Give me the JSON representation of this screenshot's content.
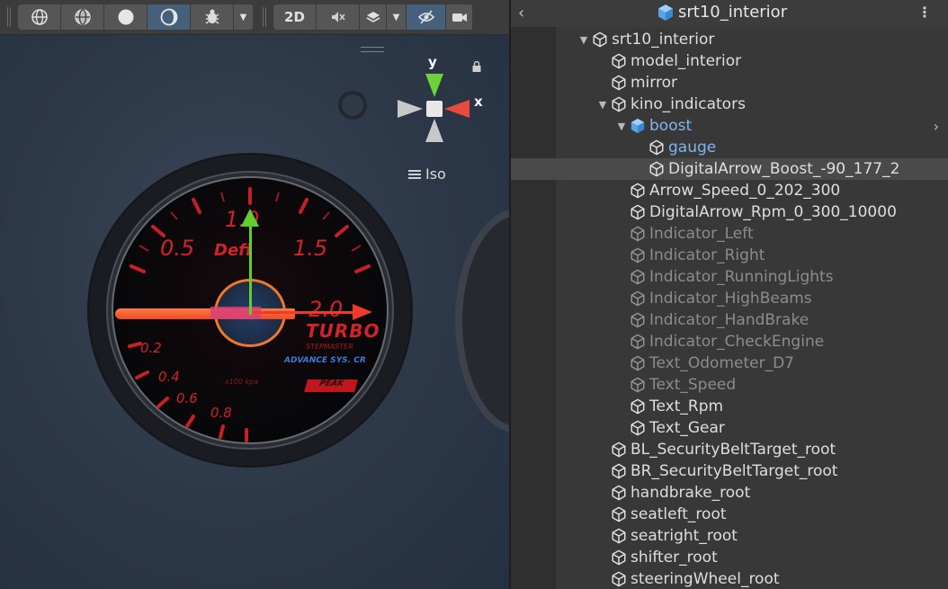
{
  "toolbar": {
    "buttons": [
      {
        "name": "wireframe-shading-button",
        "icon": "globe-wireframe-icon"
      },
      {
        "name": "shaded-wireframe-button",
        "icon": "globe-shaded-icon"
      },
      {
        "name": "shaded-button",
        "icon": "sphere-solid-icon"
      },
      {
        "name": "unlit-button",
        "icon": "moon-icon",
        "active": true
      },
      {
        "name": "debug-button",
        "icon": "bug-icon"
      }
    ],
    "mode_2d": "2D",
    "audio_icon": "speaker-muted-icon",
    "effects_icon": "layers-icon",
    "visibility_icon": "eye-off-icon",
    "camera_icon": "camera-icon"
  },
  "gauge": {
    "marks_major": [
      "1.0",
      "0.5",
      "1.5",
      "2.0"
    ],
    "marks_minor": [
      "0.2",
      "0.4",
      "0.6",
      "0.8"
    ],
    "brand": "Defi",
    "model": "TURBO",
    "line1": "STEPMASTER",
    "line2": "ADVANCE SYS. CR",
    "peak": "PEAK",
    "unit": "x100 kpa"
  },
  "gizmo": {
    "y_label": "y",
    "x_label": "x",
    "projection": "Iso"
  },
  "hierarchy": {
    "title": "srt10_interior",
    "items": [
      {
        "label": "srt10_interior",
        "depth": 0,
        "arrow": "down",
        "style": "normal"
      },
      {
        "label": "model_interior",
        "depth": 1,
        "arrow": "",
        "style": "normal"
      },
      {
        "label": "mirror",
        "depth": 1,
        "arrow": "",
        "style": "normal"
      },
      {
        "label": "kino_indicators",
        "depth": 1,
        "arrow": "down",
        "style": "normal"
      },
      {
        "label": "boost",
        "depth": 2,
        "arrow": "down",
        "style": "prefab"
      },
      {
        "label": "gauge",
        "depth": 3,
        "arrow": "",
        "style": "prefab"
      },
      {
        "label": "DigitalArrow_Boost_-90_177_2",
        "depth": 3,
        "arrow": "",
        "style": "selected"
      },
      {
        "label": "Arrow_Speed_0_202_300",
        "depth": 2,
        "arrow": "",
        "style": "normal"
      },
      {
        "label": "DigitalArrow_Rpm_0_300_10000",
        "depth": 2,
        "arrow": "",
        "style": "normal"
      },
      {
        "label": "Indicator_Left",
        "depth": 2,
        "arrow": "",
        "style": "dim"
      },
      {
        "label": "Indicator_Right",
        "depth": 2,
        "arrow": "",
        "style": "dim"
      },
      {
        "label": "Indicator_RunningLights",
        "depth": 2,
        "arrow": "",
        "style": "dim"
      },
      {
        "label": "Indicator_HighBeams",
        "depth": 2,
        "arrow": "",
        "style": "dim"
      },
      {
        "label": "Indicator_HandBrake",
        "depth": 2,
        "arrow": "",
        "style": "dim"
      },
      {
        "label": "Indicator_CheckEngine",
        "depth": 2,
        "arrow": "",
        "style": "dim"
      },
      {
        "label": "Text_Odometer_D7",
        "depth": 2,
        "arrow": "",
        "style": "dim"
      },
      {
        "label": "Text_Speed",
        "depth": 2,
        "arrow": "",
        "style": "dim"
      },
      {
        "label": "Text_Rpm",
        "depth": 2,
        "arrow": "",
        "style": "normal"
      },
      {
        "label": "Text_Gear",
        "depth": 2,
        "arrow": "",
        "style": "normal"
      },
      {
        "label": "BL_SecurityBeltTarget_root",
        "depth": 1,
        "arrow": "",
        "style": "normal"
      },
      {
        "label": "BR_SecurityBeltTarget_root",
        "depth": 1,
        "arrow": "",
        "style": "normal"
      },
      {
        "label": "handbrake_root",
        "depth": 1,
        "arrow": "",
        "style": "normal"
      },
      {
        "label": "seatleft_root",
        "depth": 1,
        "arrow": "",
        "style": "normal"
      },
      {
        "label": "seatright_root",
        "depth": 1,
        "arrow": "",
        "style": "normal"
      },
      {
        "label": "shifter_root",
        "depth": 1,
        "arrow": "",
        "style": "normal"
      },
      {
        "label": "steeringWheel_root",
        "depth": 1,
        "arrow": "",
        "style": "normal"
      }
    ]
  },
  "colors": {
    "prefab_blue": "#82b4ec",
    "axis_x": "#ee3a2a",
    "axis_y": "#5fcf30",
    "gauge_red": "#d2222a",
    "needle": "#ff7a40"
  }
}
